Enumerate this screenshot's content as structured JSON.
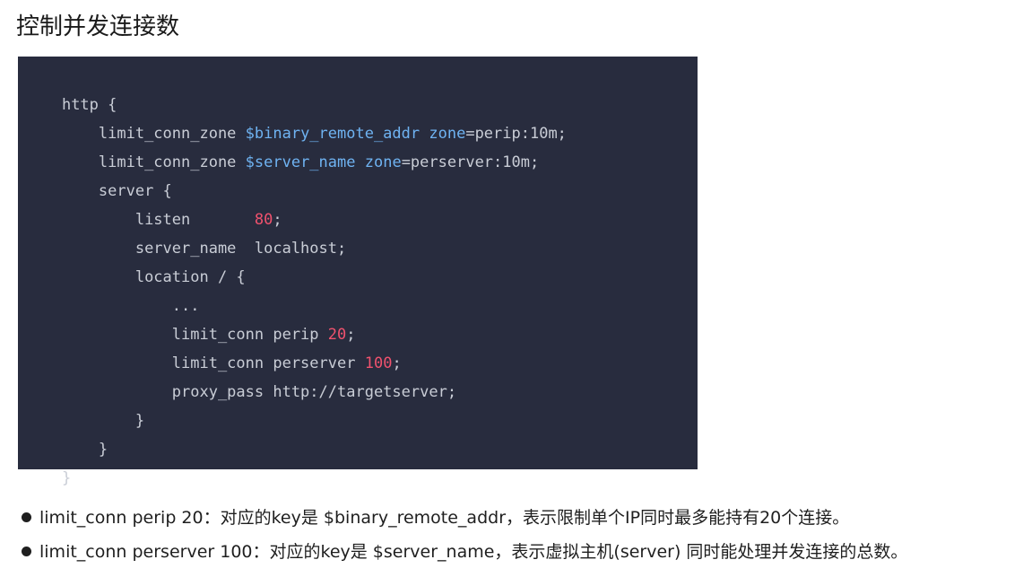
{
  "title": "控制并发连接数",
  "code": {
    "lines": [
      [
        "http {"
      ],
      [
        "    limit_conn_zone ",
        "$binary_remote_addr",
        " ",
        "zone",
        "=perip:10m;"
      ],
      [
        "    limit_conn_zone ",
        "$server_name",
        " ",
        "zone",
        "=perserver:10m;"
      ],
      [
        "    server {"
      ],
      [
        "        listen       ",
        "80",
        ";"
      ],
      [
        "        server_name  localhost;"
      ],
      [
        "        location / {"
      ],
      [
        "            ..."
      ],
      [
        "            limit_conn perip ",
        "20",
        ";"
      ],
      [
        "            limit_conn perserver ",
        "100",
        ";"
      ],
      [
        "            proxy_pass http://targetserver;"
      ],
      [
        "        }"
      ],
      [
        "    }"
      ],
      [
        "}"
      ]
    ]
  },
  "bullets": [
    "limit_conn perip 20：对应的key是 $binary_remote_addr，表示限制单个IP同时最多能持有20个连接。",
    "limit_conn perserver 100：对应的key是 $server_name，表示虚拟主机(server) 同时能处理并发连接的总数。"
  ]
}
